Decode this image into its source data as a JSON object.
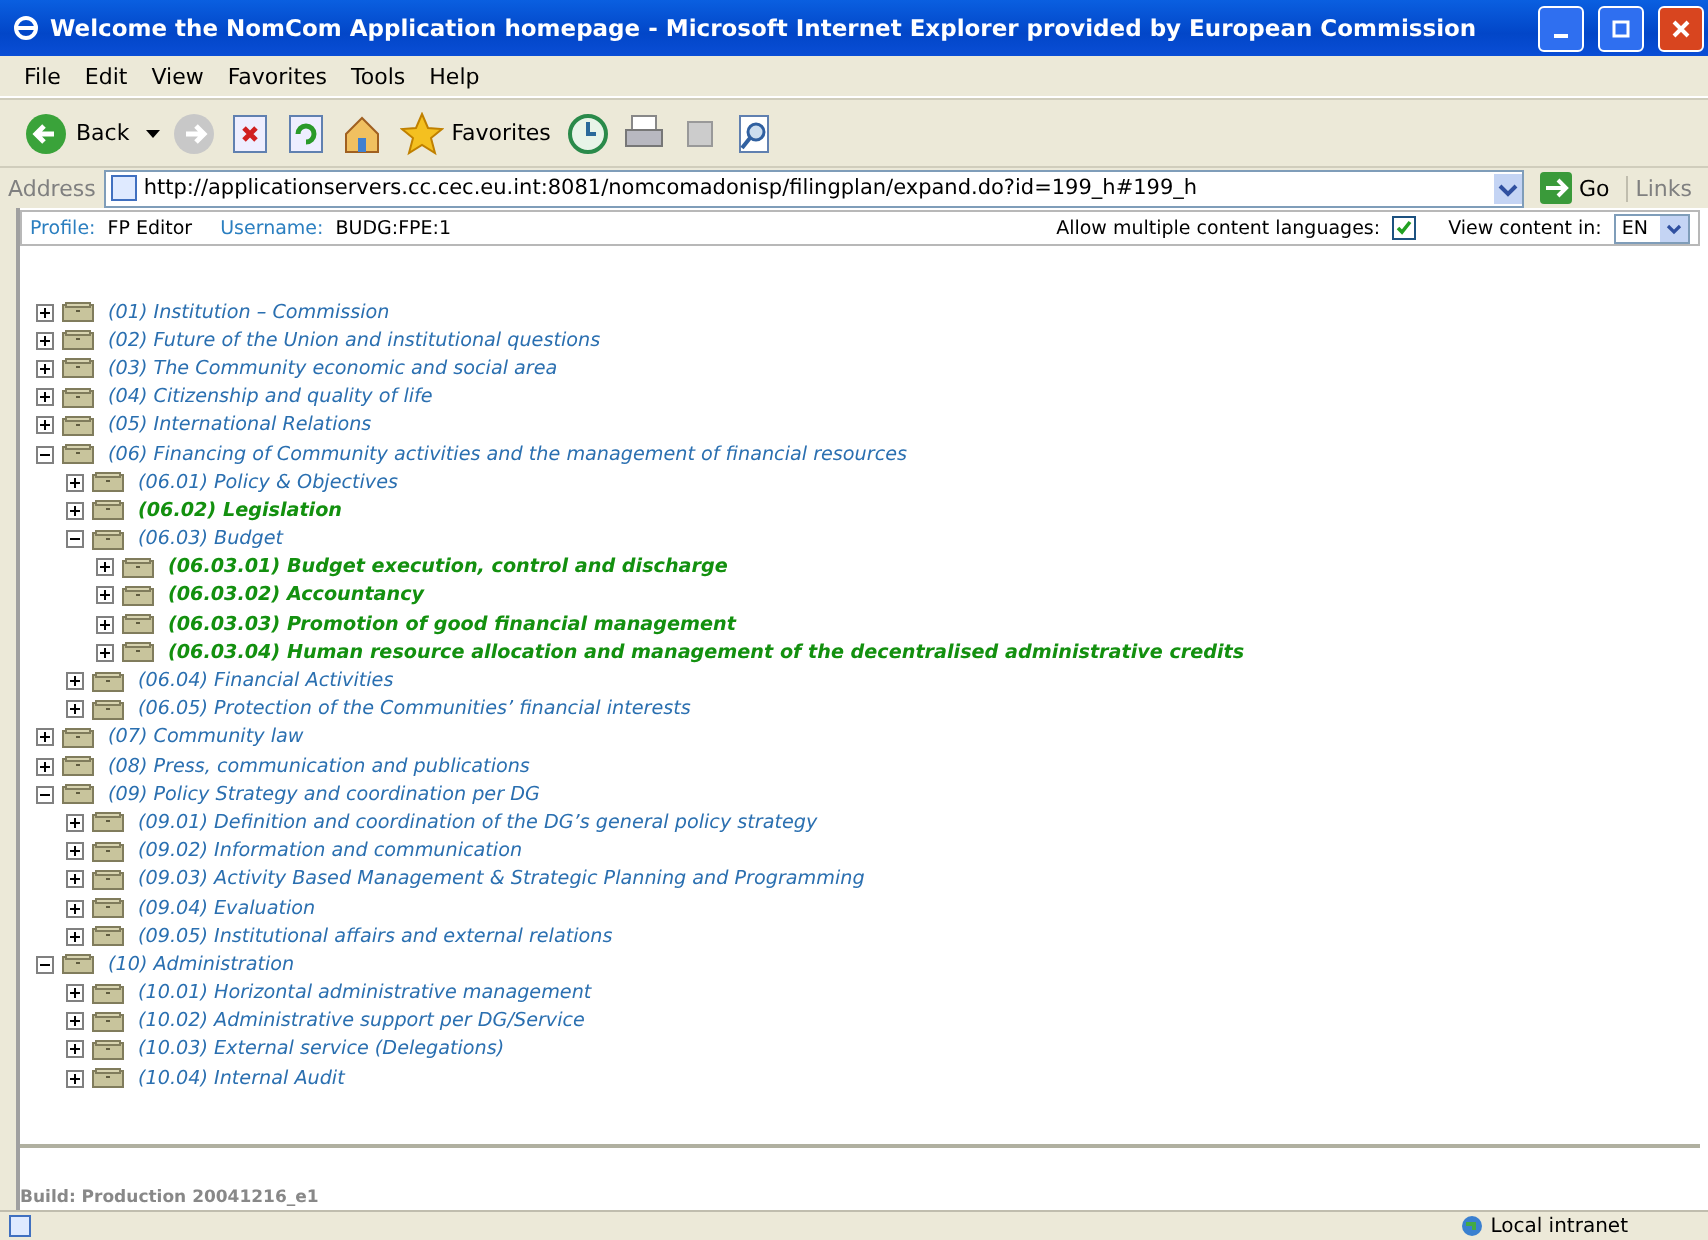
{
  "window": {
    "title": "Welcome the NomCom Application homepage - Microsoft Internet Explorer provided by European Commission"
  },
  "menu": [
    "File",
    "Edit",
    "View",
    "Favorites",
    "Tools",
    "Help"
  ],
  "toolbar": {
    "back": "Back",
    "favorites": "Favorites"
  },
  "address": {
    "label": "Address",
    "url": "http://applicationservers.cc.cec.eu.int:8081/nomcomadonisp/filingplan/expand.do?id=199_h#199_h",
    "go": "Go",
    "links": "Links"
  },
  "profile": {
    "profile_label": "Profile:",
    "profile": "FP Editor",
    "username_label": "Username:",
    "username": "BUDG:FPE:1",
    "allow_label": "Allow multiple content languages:",
    "allow_checked": true,
    "view_label": "View content in:",
    "language": "EN"
  },
  "tree": [
    {
      "label": "(01) Institution – Commission",
      "expanded": false,
      "highlighted": false
    },
    {
      "label": "(02) Future of the Union and institutional questions",
      "expanded": false,
      "highlighted": false
    },
    {
      "label": "(03) The Community economic and social area",
      "expanded": false,
      "highlighted": false
    },
    {
      "label": "(04) Citizenship and quality of life",
      "expanded": false,
      "highlighted": false
    },
    {
      "label": "(05) International Relations",
      "expanded": false,
      "highlighted": false
    },
    {
      "label": "(06) Financing of Community activities and the management of financial resources",
      "expanded": true,
      "highlighted": false,
      "children": [
        {
          "label": "(06.01) Policy & Objectives",
          "expanded": false,
          "highlighted": false
        },
        {
          "label": "(06.02) Legislation",
          "expanded": false,
          "highlighted": true
        },
        {
          "label": "(06.03) Budget",
          "expanded": true,
          "highlighted": false,
          "children": [
            {
              "label": "(06.03.01) Budget execution, control and discharge",
              "expanded": false,
              "highlighted": true
            },
            {
              "label": "(06.03.02) Accountancy",
              "expanded": false,
              "highlighted": true
            },
            {
              "label": "(06.03.03) Promotion of good financial management",
              "expanded": false,
              "highlighted": true
            },
            {
              "label": "(06.03.04) Human resource allocation and management of the decentralised administrative credits",
              "expanded": false,
              "highlighted": true
            }
          ]
        },
        {
          "label": "(06.04) Financial Activities",
          "expanded": false,
          "highlighted": false
        },
        {
          "label": "(06.05) Protection of the Communities’ financial interests",
          "expanded": false,
          "highlighted": false
        }
      ]
    },
    {
      "label": "(07) Community law",
      "expanded": false,
      "highlighted": false
    },
    {
      "label": "(08) Press, communication and publications",
      "expanded": false,
      "highlighted": false
    },
    {
      "label": "(09) Policy Strategy and coordination per DG",
      "expanded": true,
      "highlighted": false,
      "children": [
        {
          "label": "(09.01) Definition and coordination of the DG’s general policy strategy",
          "expanded": false,
          "highlighted": false
        },
        {
          "label": "(09.02) Information and communication",
          "expanded": false,
          "highlighted": false
        },
        {
          "label": "(09.03) Activity Based Management & Strategic Planning and Programming",
          "expanded": false,
          "highlighted": false
        },
        {
          "label": "(09.04) Evaluation",
          "expanded": false,
          "highlighted": false
        },
        {
          "label": "(09.05) Institutional affairs and external relations",
          "expanded": false,
          "highlighted": false
        }
      ]
    },
    {
      "label": "(10) Administration",
      "expanded": true,
      "highlighted": false,
      "children": [
        {
          "label": "(10.01) Horizontal administrative management",
          "expanded": false,
          "highlighted": false
        },
        {
          "label": "(10.02) Administrative support per DG/Service",
          "expanded": false,
          "highlighted": false
        },
        {
          "label": "(10.03) External service (Delegations)",
          "expanded": false,
          "highlighted": false
        },
        {
          "label": "(10.04) Internal Audit",
          "expanded": false,
          "highlighted": false
        }
      ]
    }
  ],
  "build": "Build: Production 20041216_e1",
  "status_bar": {
    "zone": "Local intranet"
  }
}
